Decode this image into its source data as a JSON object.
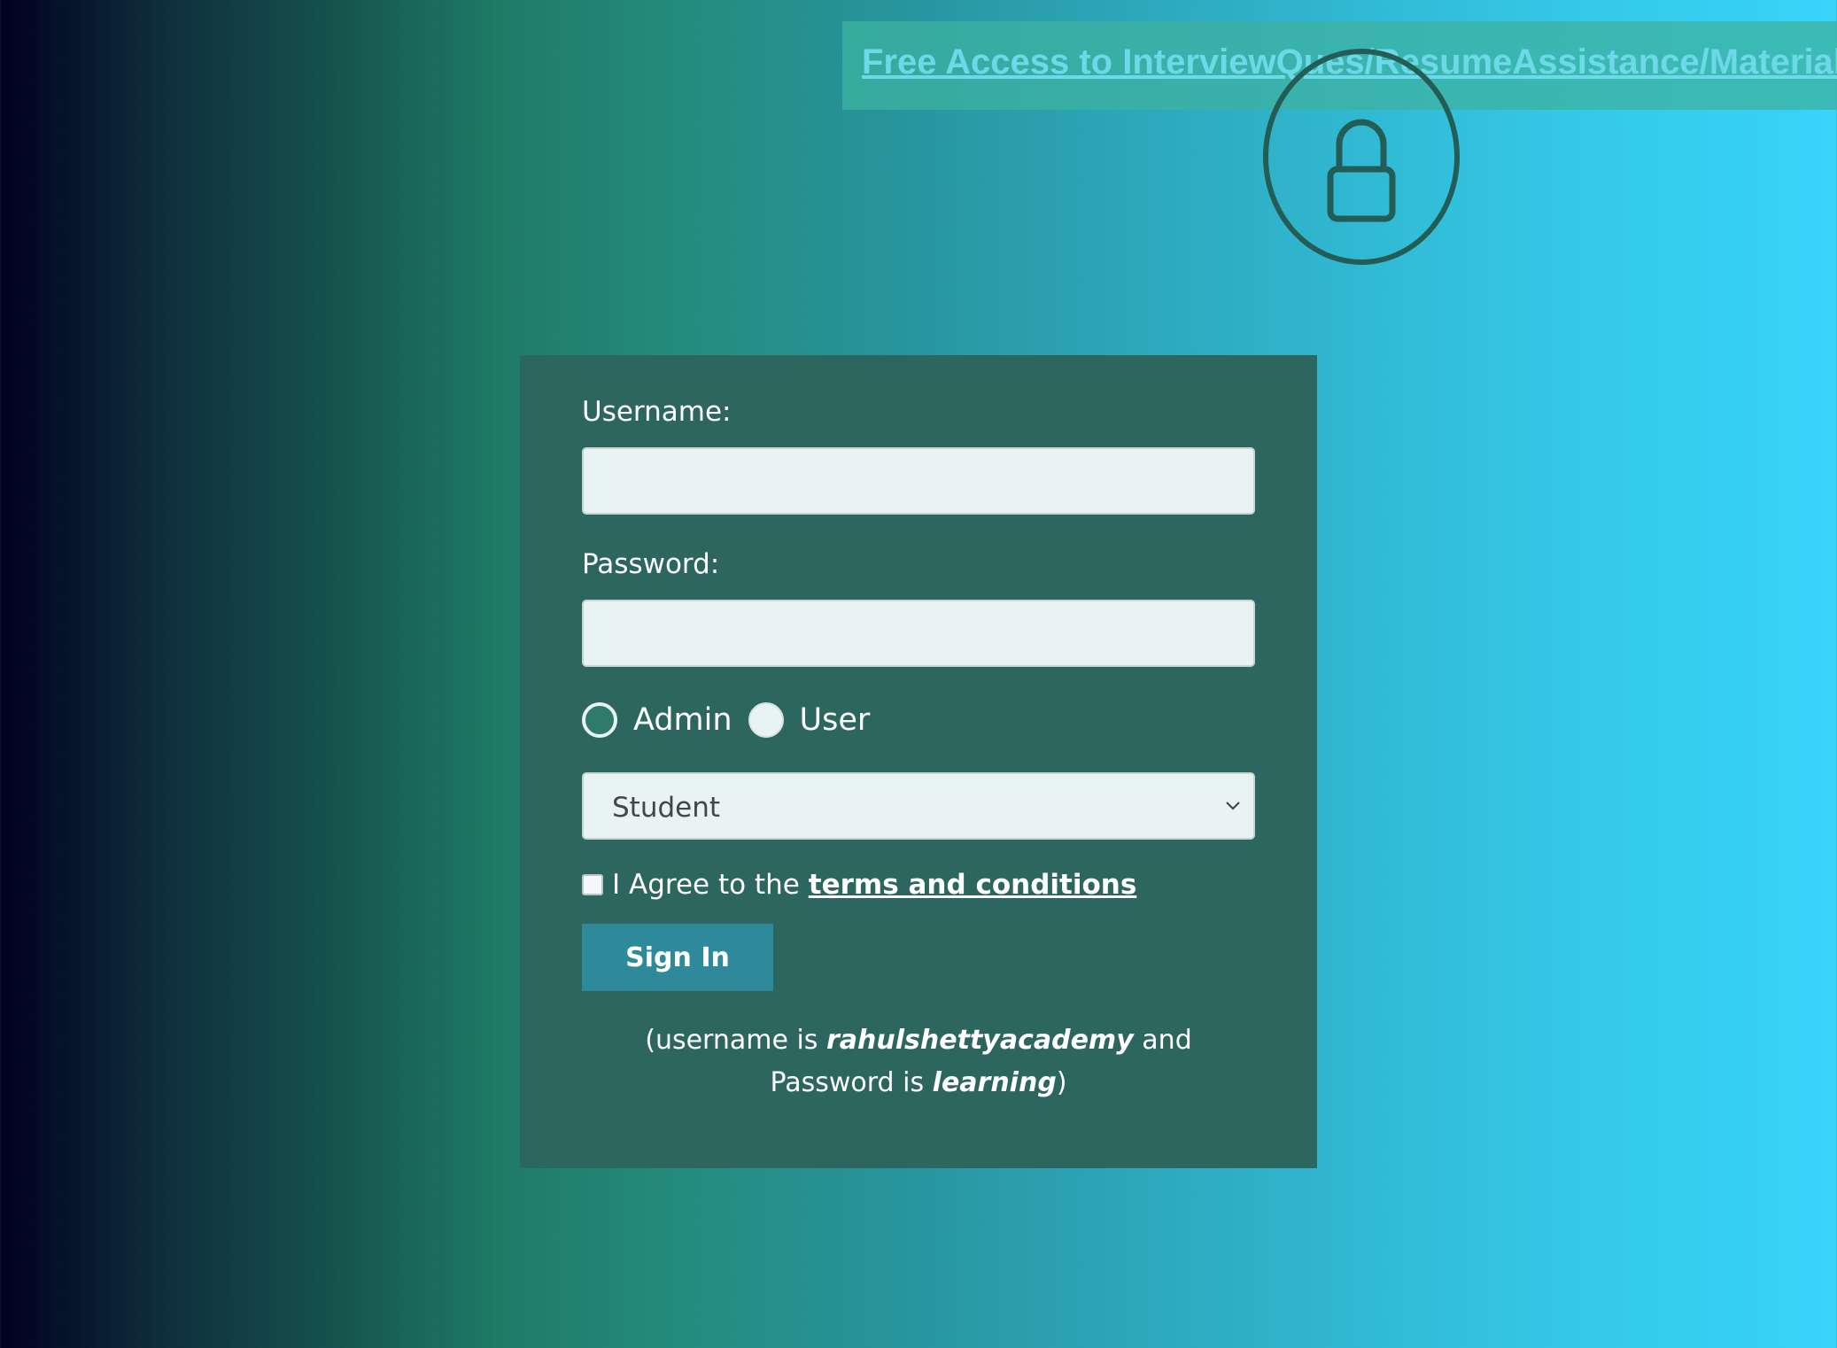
{
  "banner": {
    "link_text": "Free Access to InterviewQues/ResumeAssistance/Material"
  },
  "icons": {
    "lock": "lock-icon",
    "dropdown": "chevron-down-icon"
  },
  "form": {
    "username_label": "Username:",
    "username_value": "",
    "password_label": "Password:",
    "password_value": "",
    "role_options": [
      {
        "label": "Admin",
        "selected": true
      },
      {
        "label": "User",
        "selected": false
      }
    ],
    "select_value": "Student",
    "terms_text": "I Agree to the",
    "terms_link": "terms and conditions",
    "terms_checked": false,
    "sign_in_label": "Sign In",
    "hint_prefix": "(username is",
    "hint_username": "rahulshettyacademy",
    "hint_middle": "and Password is",
    "hint_password": "learning",
    "hint_suffix": ")"
  },
  "colors": {
    "card_background": "#2c665f",
    "button_background": "#2e8a9a",
    "banner_link": "#6cd8e8"
  }
}
